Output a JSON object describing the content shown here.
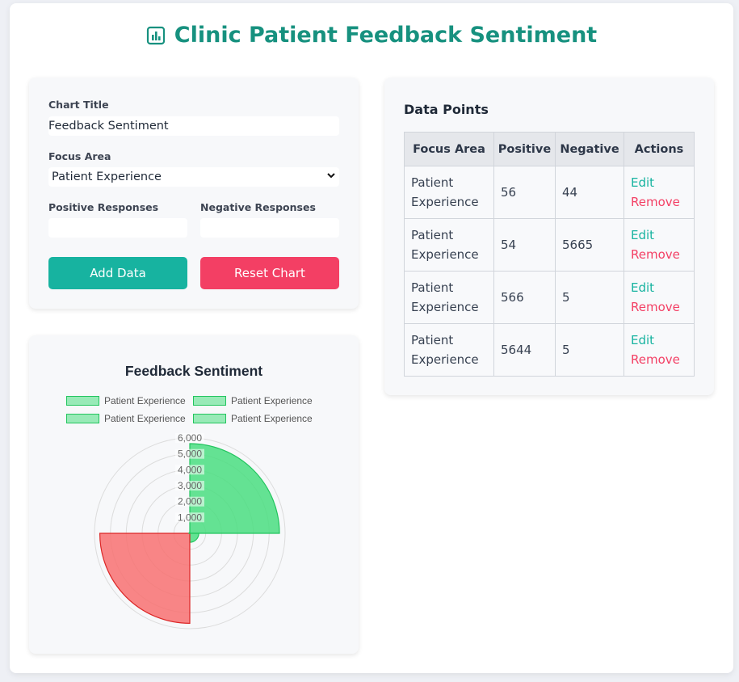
{
  "app": {
    "title": "Clinic Patient Feedback Sentiment",
    "icon": "bar-chart-icon",
    "accent_color": "#17917f"
  },
  "form": {
    "chart_title_label": "Chart Title",
    "chart_title_value": "Feedback Sentiment",
    "focus_area_label": "Focus Area",
    "focus_area_selected": "Patient Experience",
    "positive_label": "Positive Responses",
    "positive_value": "",
    "negative_label": "Negative Responses",
    "negative_value": "",
    "add_button": "Add Data",
    "reset_button": "Reset Chart",
    "add_color": "#17b3a0",
    "reset_color": "#f33f64"
  },
  "table": {
    "title": "Data Points",
    "headers": [
      "Focus Area",
      "Positive",
      "Negative",
      "Actions"
    ],
    "edit_label": "Edit",
    "remove_label": "Remove",
    "rows": [
      {
        "focus": "Patient Experience",
        "positive": "56",
        "negative": "44"
      },
      {
        "focus": "Patient Experience",
        "positive": "54",
        "negative": "5665"
      },
      {
        "focus": "Patient Experience",
        "positive": "566",
        "negative": "5"
      },
      {
        "focus": "Patient Experience",
        "positive": "5644",
        "negative": "5"
      }
    ]
  },
  "chart_data": {
    "type": "polarArea",
    "title": "Feedback Sentiment",
    "legend": [
      "Patient Experience",
      "Patient Experience",
      "Patient Experience",
      "Patient Experience"
    ],
    "legend_position": "top",
    "values": [
      5644,
      566,
      5665,
      54
    ],
    "colors": [
      "#4ade80",
      "#4ade80",
      "#f87171",
      "#4ade80"
    ],
    "r_ticks": [
      "1,000",
      "2,000",
      "3,000",
      "4,000",
      "5,000",
      "6,000"
    ],
    "r_max": 6000,
    "grid": true
  }
}
